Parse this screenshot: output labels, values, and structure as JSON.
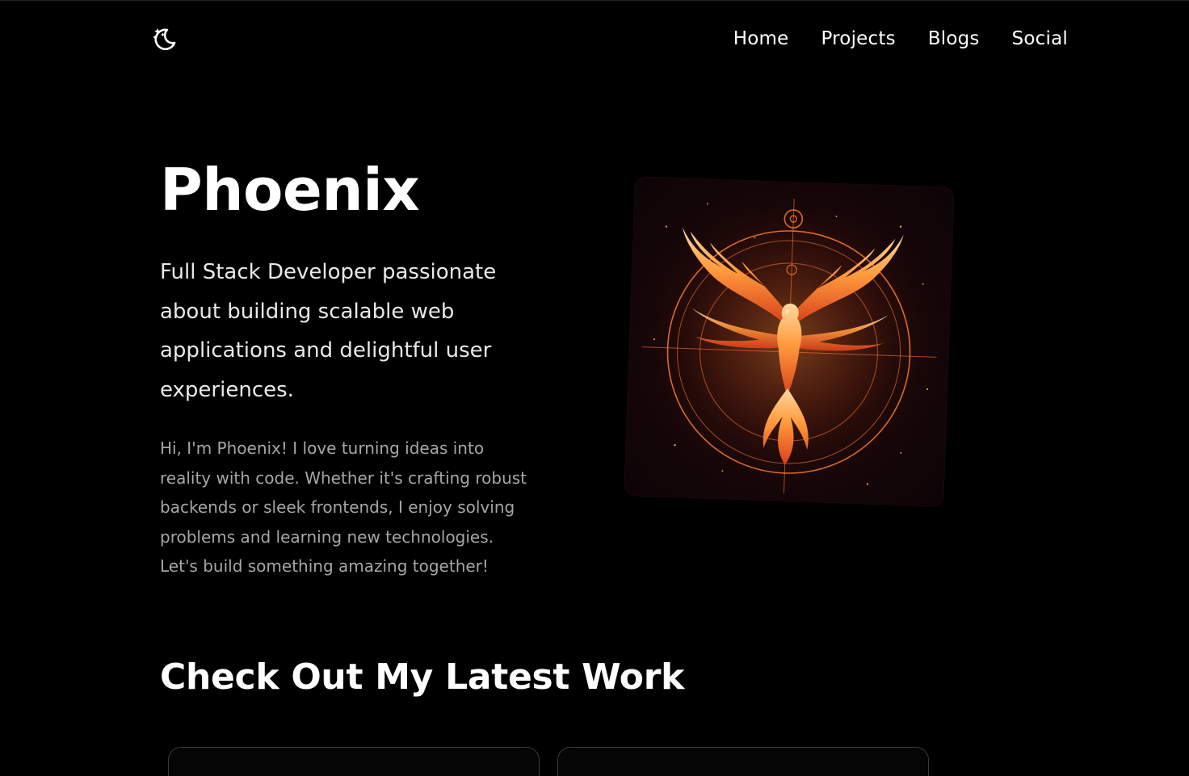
{
  "header": {
    "theme_toggle_icon": "moon-stars-icon",
    "nav": [
      {
        "label": "Home"
      },
      {
        "label": "Projects"
      },
      {
        "label": "Blogs"
      },
      {
        "label": "Social"
      }
    ]
  },
  "hero": {
    "name": "Phoenix",
    "tagline": "Full Stack Developer passionate about building scalable web applications and delightful user experiences.",
    "intro": "Hi, I'm Phoenix! I love turning ideas into reality with code. Whether it's crafting robust backends or sleek frontends, I enjoy solving problems and learning new technologies. Let's build something amazing together!",
    "image_icon": "phoenix-emblem-image"
  },
  "work": {
    "title": "Check Out My Latest Work"
  },
  "colors": {
    "background": "#000000",
    "text": "#ffffff",
    "muted_text": "#a6a6a6",
    "accent_fire": "#ff8a2a"
  }
}
